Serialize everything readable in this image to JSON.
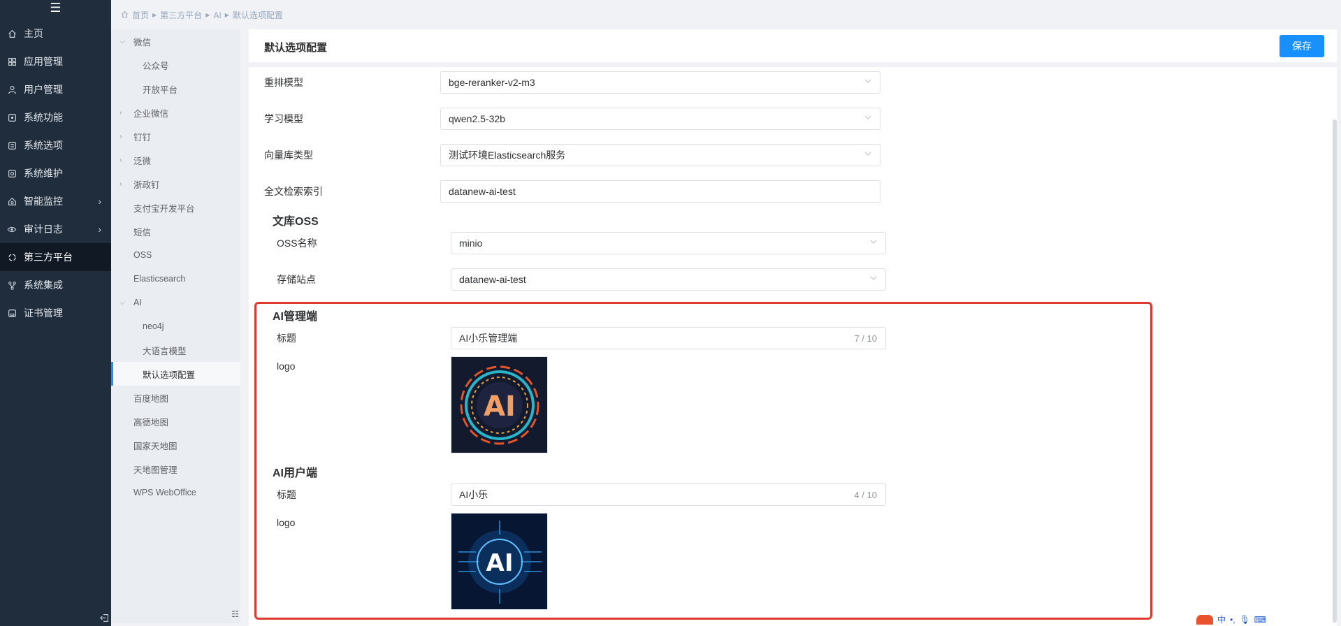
{
  "sidebar": {
    "items": [
      {
        "label": "主页",
        "icon": "home-icon"
      },
      {
        "label": "应用管理",
        "icon": "apps-icon"
      },
      {
        "label": "用户管理",
        "icon": "user-icon"
      },
      {
        "label": "系统功能",
        "icon": "function-icon"
      },
      {
        "label": "系统选项",
        "icon": "options-icon"
      },
      {
        "label": "系统维护",
        "icon": "maintenance-icon"
      },
      {
        "label": "智能监控",
        "icon": "monitor-icon"
      },
      {
        "label": "审计日志",
        "icon": "eye-icon"
      },
      {
        "label": "第三方平台",
        "icon": "platform-icon"
      },
      {
        "label": "系统集成",
        "icon": "integration-icon"
      },
      {
        "label": "证书管理",
        "icon": "certificate-icon"
      }
    ]
  },
  "breadcrumb": {
    "home": "首页",
    "level1": "第三方平台",
    "level2": "AI",
    "level3": "默认选项配置"
  },
  "subnav": {
    "items": [
      {
        "label": "微信"
      },
      {
        "label": "公众号"
      },
      {
        "label": "开放平台"
      },
      {
        "label": "企业微信"
      },
      {
        "label": "钉钉"
      },
      {
        "label": "泛微"
      },
      {
        "label": "浙政钉"
      },
      {
        "label": "支付宝开发平台"
      },
      {
        "label": "短信"
      },
      {
        "label": "OSS"
      },
      {
        "label": "Elasticsearch"
      },
      {
        "label": "AI"
      },
      {
        "label": "neo4j"
      },
      {
        "label": "大语言模型"
      },
      {
        "label": "默认选项配置"
      },
      {
        "label": "百度地图"
      },
      {
        "label": "高德地图"
      },
      {
        "label": "国家天地图"
      },
      {
        "label": "天地图管理"
      },
      {
        "label": "WPS WebOffice"
      }
    ]
  },
  "header": {
    "title": "默认选项配置",
    "save_label": "保存"
  },
  "form": {
    "rerank": {
      "label": "重排模型",
      "value": "bge-reranker-v2-m3"
    },
    "learn": {
      "label": "学习模型",
      "value": "qwen2.5-32b"
    },
    "vector": {
      "label": "向量库类型",
      "value": "测试环境Elasticsearch服务"
    },
    "fulltext": {
      "label": "全文检索索引",
      "value": "datanew-ai-test"
    }
  },
  "oss": {
    "title": "文库OSS",
    "name": {
      "label": "OSS名称",
      "value": "minio"
    },
    "site": {
      "label": "存储站点",
      "value": "datanew-ai-test"
    }
  },
  "ai_admin": {
    "title": "AI管理端",
    "title_field": {
      "label": "标题",
      "value": "AI小乐管理端",
      "count": "7 / 10"
    },
    "logo_label": "logo",
    "logo_text": "AI"
  },
  "ai_user": {
    "title": "AI用户端",
    "title_field": {
      "label": "标题",
      "value": "AI小乐",
      "count": "4 / 10"
    },
    "logo_label": "logo",
    "logo_text": "AI"
  },
  "ime": {
    "lang": "中"
  },
  "colors": {
    "accent": "#1890ff",
    "highlight": "#e03a2f",
    "sidebar": "#1f2d3d"
  }
}
